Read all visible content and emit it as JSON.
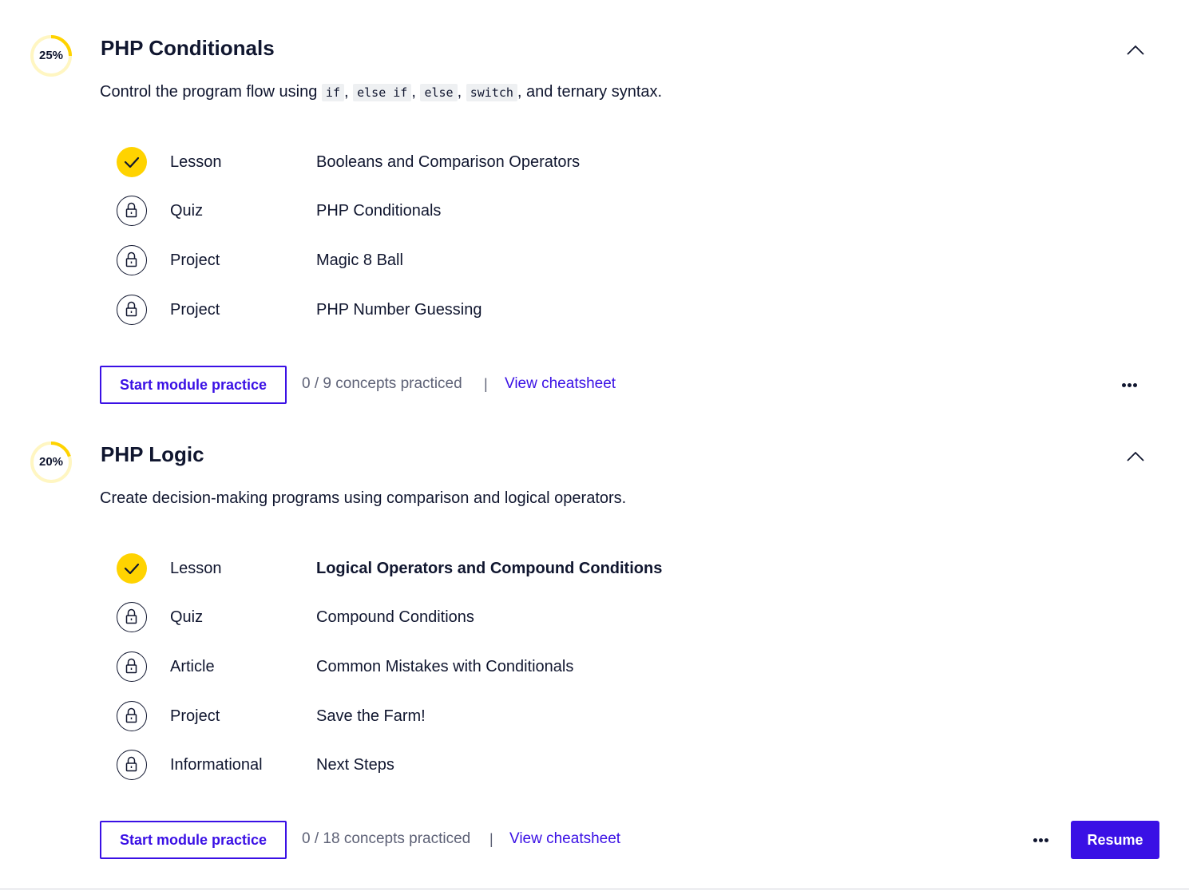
{
  "colors": {
    "accent": "#3a10e5",
    "progress": "#ffd300",
    "progress_track": "#fff6c2",
    "text": "#10162f",
    "muted": "#5d6176"
  },
  "modules": [
    {
      "progress_fraction": 0.25,
      "progress_label": "25%",
      "title": "PHP Conditionals",
      "description": {
        "prefix": "Control the program flow using ",
        "codes": [
          "if",
          "else if",
          "else",
          "switch"
        ],
        "separators": [
          ", ",
          ", ",
          ", ",
          ", and ternary syntax."
        ]
      },
      "items": [
        {
          "status": "completed",
          "status_icon": "check-icon",
          "type": "Lesson",
          "name": "Booleans and Comparison Operators"
        },
        {
          "status": "locked",
          "status_icon": "lock-icon",
          "type": "Quiz",
          "name": "PHP Conditionals"
        },
        {
          "status": "locked",
          "status_icon": "lock-icon",
          "type": "Project",
          "name": "Magic 8 Ball"
        },
        {
          "status": "locked",
          "status_icon": "lock-icon",
          "type": "Project",
          "name": "PHP Number Guessing"
        }
      ],
      "practice_label": "Start module practice",
      "concepts_text": "0 / 9 concepts practiced",
      "separator": "|",
      "cheatsheet_label": "View cheatsheet",
      "more_icon": "ellipsis-icon",
      "collapse_icon": "chevron-up-icon"
    },
    {
      "progress_fraction": 0.2,
      "progress_label": "20%",
      "title": "PHP Logic",
      "description_text": "Create decision-making programs using comparison and logical operators.",
      "items": [
        {
          "status": "completed",
          "status_icon": "check-icon",
          "type": "Lesson",
          "name": "Logical Operators and Compound Conditions",
          "current": true
        },
        {
          "status": "locked",
          "status_icon": "lock-icon",
          "type": "Quiz",
          "name": "Compound Conditions"
        },
        {
          "status": "locked",
          "status_icon": "lock-icon",
          "type": "Article",
          "name": "Common Mistakes with Conditionals"
        },
        {
          "status": "locked",
          "status_icon": "lock-icon",
          "type": "Project",
          "name": "Save the Farm!"
        },
        {
          "status": "locked",
          "status_icon": "lock-icon",
          "type": "Informational",
          "name": "Next Steps"
        }
      ],
      "practice_label": "Start module practice",
      "concepts_text": "0 / 18 concepts practiced",
      "separator": "|",
      "cheatsheet_label": "View cheatsheet",
      "more_icon": "ellipsis-icon",
      "collapse_icon": "chevron-up-icon",
      "resume_label": "Resume"
    }
  ]
}
